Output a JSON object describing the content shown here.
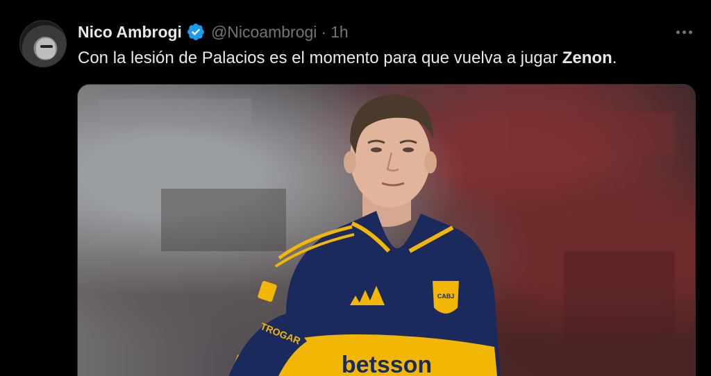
{
  "tweet": {
    "author_name": "Nico Ambrogi",
    "handle": "@Nicoambrogi",
    "separator": "·",
    "time": "1h",
    "text_before": "Con la lesión de Palacios es el momento para que vuelva a jugar ",
    "text_bold": "Zenon",
    "text_after": ".",
    "verified_color": "#1d9bf0",
    "more_icon": "more-horizontal-icon",
    "media": {
      "shirt_sponsor": "betsson",
      "sleeve_text": "TROGAR",
      "crest_text": "CABJ",
      "shirt_colors": [
        "#1b2a5c",
        "#f2b705"
      ]
    }
  }
}
